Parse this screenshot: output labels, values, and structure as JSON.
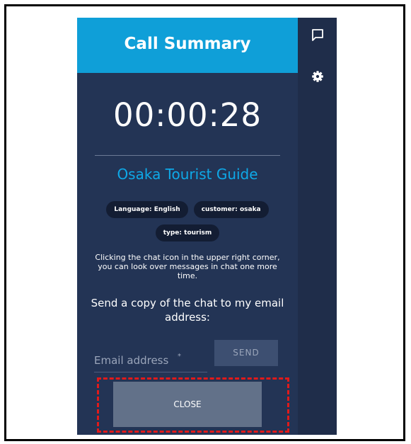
{
  "header": {
    "title": "Call Summary"
  },
  "call": {
    "duration": "00:00:28",
    "name": "Osaka Tourist Guide",
    "tags": [
      "Language: English",
      "customer: osaka",
      "type: tourism"
    ],
    "info": "Clicking the chat icon in the upper right corner, you can look over messages in chat one more time."
  },
  "email": {
    "heading": "Send a copy of the chat to my email address:",
    "placeholder": "Email address",
    "required_mark": "*",
    "send_label": "SEND"
  },
  "actions": {
    "close_label": "CLOSE"
  },
  "sidebar": {
    "icons": [
      "chat-icon",
      "gear-icon"
    ]
  },
  "colors": {
    "header": "#0f9fd8",
    "panel": "#233455",
    "sidebar": "#1f2d4a",
    "accent_text": "#0ea9e8",
    "highlight": "#e11a1a"
  }
}
